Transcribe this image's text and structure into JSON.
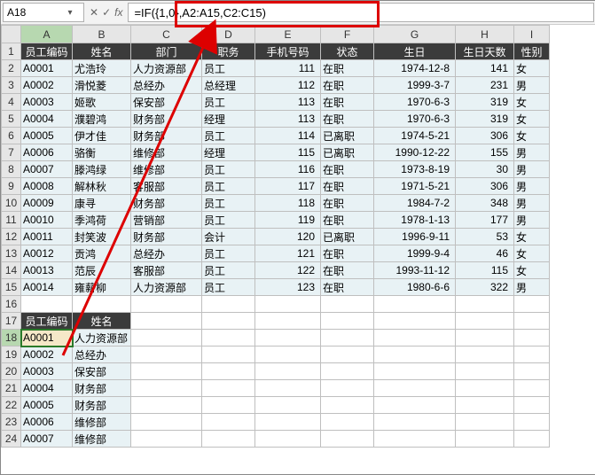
{
  "nameBox": {
    "value": "A18"
  },
  "fx": {
    "cancel": "✕",
    "enter": "✓",
    "label": "fx"
  },
  "formula": {
    "value": "=IF({1,0},A2:A15,C2:C15)"
  },
  "columns": [
    "A",
    "B",
    "C",
    "D",
    "E",
    "F",
    "G",
    "H",
    "I"
  ],
  "headers1": [
    "员工编码",
    "姓名",
    "部门",
    "职务",
    "手机号码",
    "状态",
    "生日",
    "生日天数",
    "性别"
  ],
  "rows": [
    {
      "n": "2",
      "c": [
        "A0001",
        "尤浩玲",
        "人力资源部",
        "员工",
        "111",
        "在职",
        "1974-12-8",
        "141",
        "女"
      ]
    },
    {
      "n": "3",
      "c": [
        "A0002",
        "滑悦菱",
        "总经办",
        "总经理",
        "112",
        "在职",
        "1999-3-7",
        "231",
        "男"
      ]
    },
    {
      "n": "4",
      "c": [
        "A0003",
        "姬歌",
        "保安部",
        "员工",
        "113",
        "在职",
        "1970-6-3",
        "319",
        "女"
      ]
    },
    {
      "n": "5",
      "c": [
        "A0004",
        "濮碧鸿",
        "财务部",
        "经理",
        "113",
        "在职",
        "1970-6-3",
        "319",
        "女"
      ]
    },
    {
      "n": "6",
      "c": [
        "A0005",
        "伊才佳",
        "财务部",
        "员工",
        "114",
        "已离职",
        "1974-5-21",
        "306",
        "女"
      ]
    },
    {
      "n": "7",
      "c": [
        "A0006",
        "骆衡",
        "维修部",
        "经理",
        "115",
        "已离职",
        "1990-12-22",
        "155",
        "男"
      ]
    },
    {
      "n": "8",
      "c": [
        "A0007",
        "滕鸿绿",
        "维修部",
        "员工",
        "116",
        "在职",
        "1973-8-19",
        "30",
        "男"
      ]
    },
    {
      "n": "9",
      "c": [
        "A0008",
        "解林秋",
        "客服部",
        "员工",
        "117",
        "在职",
        "1971-5-21",
        "306",
        "男"
      ]
    },
    {
      "n": "10",
      "c": [
        "A0009",
        "康寻",
        "财务部",
        "员工",
        "118",
        "在职",
        "1984-7-2",
        "348",
        "男"
      ]
    },
    {
      "n": "11",
      "c": [
        "A0010",
        "季鸿荷",
        "营销部",
        "员工",
        "119",
        "在职",
        "1978-1-13",
        "177",
        "男"
      ]
    },
    {
      "n": "12",
      "c": [
        "A0011",
        "封笑波",
        "财务部",
        "会计",
        "120",
        "已离职",
        "1996-9-11",
        "53",
        "女"
      ]
    },
    {
      "n": "13",
      "c": [
        "A0012",
        "贡鸿",
        "总经办",
        "员工",
        "121",
        "在职",
        "1999-9-4",
        "46",
        "女"
      ]
    },
    {
      "n": "14",
      "c": [
        "A0013",
        "范辰",
        "客服部",
        "员工",
        "122",
        "在职",
        "1993-11-12",
        "115",
        "女"
      ]
    },
    {
      "n": "15",
      "c": [
        "A0014",
        "雍薪柳",
        "人力资源部",
        "员工",
        "123",
        "在职",
        "1980-6-6",
        "322",
        "男"
      ]
    }
  ],
  "headers2": [
    "员工编码",
    "姓名"
  ],
  "rows2": [
    {
      "n": "18",
      "c": [
        "A0001",
        "人力资源部"
      ]
    },
    {
      "n": "19",
      "c": [
        "A0002",
        "总经办"
      ]
    },
    {
      "n": "20",
      "c": [
        "A0003",
        "保安部"
      ]
    },
    {
      "n": "21",
      "c": [
        "A0004",
        "财务部"
      ]
    },
    {
      "n": "22",
      "c": [
        "A0005",
        "财务部"
      ]
    },
    {
      "n": "23",
      "c": [
        "A0006",
        "维修部"
      ]
    },
    {
      "n": "24",
      "c": [
        "A0007",
        "维修部"
      ]
    }
  ],
  "rowLabels": {
    "r1": "1",
    "r16": "16",
    "r17": "17"
  }
}
